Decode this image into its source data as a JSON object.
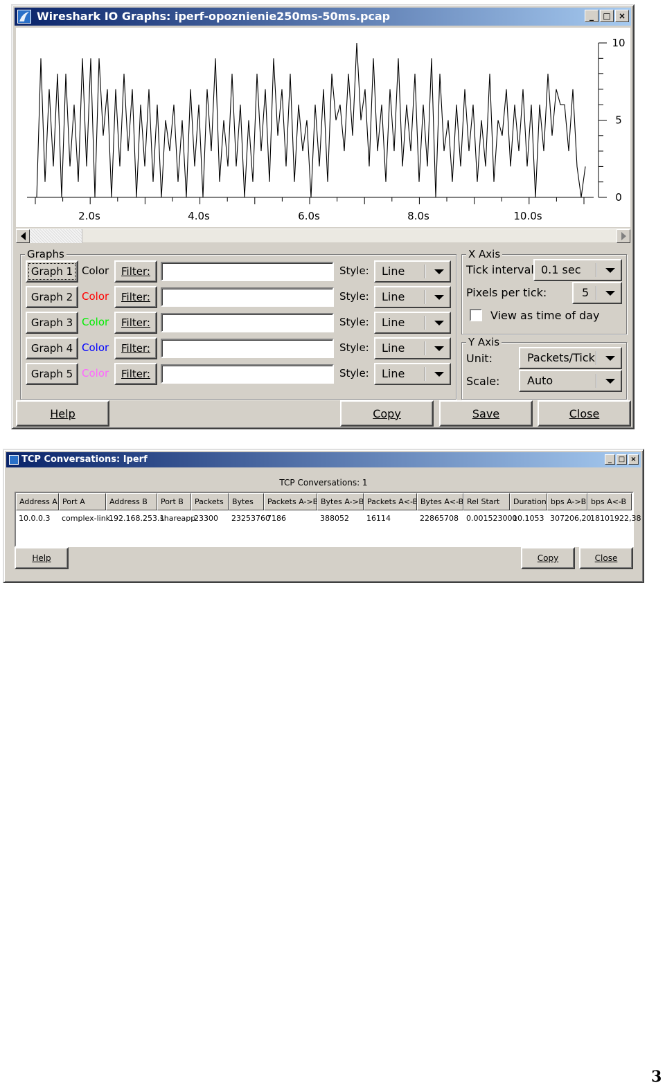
{
  "io_window": {
    "title": "Wireshark IO Graphs: iperf-opoznienie250ms-50ms.pcap",
    "title_buttons": [
      "_",
      "□",
      "×"
    ],
    "chart_data": {
      "type": "line",
      "title": "",
      "x_tick_labels": [
        "2.0s",
        "4.0s",
        "6.0s",
        "8.0s",
        "10.0s"
      ],
      "y_tick_labels": [
        "10",
        "5",
        "0"
      ],
      "ylim": [
        0,
        10
      ],
      "series": [
        {
          "values": [
            0,
            9,
            1,
            7,
            2,
            8,
            0,
            8,
            2,
            6,
            1,
            9,
            2,
            9,
            0,
            9,
            4,
            7,
            0,
            7,
            2,
            8,
            3,
            7,
            0,
            6,
            2,
            7,
            1,
            6,
            0,
            5,
            3,
            6,
            1,
            5,
            0,
            7,
            2,
            6,
            0,
            7,
            3,
            9,
            1,
            5,
            2,
            8,
            2,
            6,
            0,
            5,
            1,
            8,
            3,
            7,
            1,
            9,
            4,
            7,
            2,
            8,
            1,
            6,
            3,
            5,
            0,
            6,
            2,
            7,
            1,
            8,
            5,
            6,
            3,
            8,
            4,
            10,
            5,
            7,
            2,
            9,
            3,
            6,
            1,
            7,
            3,
            9,
            2,
            6,
            3,
            8,
            1,
            6,
            2,
            9,
            0,
            8,
            3,
            5,
            1,
            6,
            2,
            7,
            3,
            6,
            1,
            5,
            2,
            8,
            1,
            5,
            4,
            7,
            2,
            6,
            3,
            7,
            2,
            6,
            0,
            6,
            3,
            8,
            4,
            7,
            6,
            6,
            3,
            7,
            2,
            0,
            2
          ]
        }
      ],
      "grid": false
    },
    "graphs_group": {
      "legend": "Graphs",
      "rows": [
        {
          "button": "Graph 1",
          "color_label": "Color",
          "color": "#000000",
          "filter_label": "Filter:",
          "filter_value": "",
          "style_label": "Style:",
          "style_value": "Line"
        },
        {
          "button": "Graph 2",
          "color_label": "Color",
          "color": "#ff0000",
          "filter_label": "Filter:",
          "filter_value": "",
          "style_label": "Style:",
          "style_value": "Line"
        },
        {
          "button": "Graph 3",
          "color_label": "Color",
          "color": "#00ee00",
          "filter_label": "Filter:",
          "filter_value": "",
          "style_label": "Style:",
          "style_value": "Line"
        },
        {
          "button": "Graph 4",
          "color_label": "Color",
          "color": "#0000ff",
          "filter_label": "Filter:",
          "filter_value": "",
          "style_label": "Style:",
          "style_value": "Line"
        },
        {
          "button": "Graph 5",
          "color_label": "Color",
          "color": "#ff66ff",
          "filter_label": "Filter:",
          "filter_value": "",
          "style_label": "Style:",
          "style_value": "Line"
        }
      ]
    },
    "x_axis": {
      "legend": "X Axis",
      "tick_interval_label": "Tick interval:",
      "tick_interval_value": "0.1 sec",
      "pixels_per_tick_label": "Pixels per tick:",
      "pixels_per_tick_value": "5",
      "view_time_label": "View as time of day",
      "view_time_checked": false
    },
    "y_axis": {
      "legend": "Y Axis",
      "unit_label": "Unit:",
      "unit_value": "Packets/Tick",
      "scale_label": "Scale:",
      "scale_value": "Auto"
    },
    "buttons": {
      "help": "Help",
      "copy": "Copy",
      "save": "Save",
      "close": "Close"
    }
  },
  "tcp_window": {
    "title": "TCP Conversations: Iperf",
    "title_buttons": [
      "_",
      "□",
      "×"
    ],
    "caption": "TCP Conversations: 1",
    "columns": [
      "Address A",
      "Port A",
      "Address B",
      "Port B",
      "Packets",
      "Bytes",
      "Packets A->B",
      "Bytes A->B",
      "Packets A<-B",
      "Bytes A<-B",
      "Rel Start",
      "Duration",
      "bps A->B",
      "bps A<-B"
    ],
    "rows": [
      [
        "10.0.0.3",
        "complex-link",
        "192.168.253.1",
        "shareapp",
        "23300",
        "23253760",
        "7186",
        "388052",
        "16114",
        "22865708",
        "0.001523000",
        "10.1053",
        "307206,20",
        "18101922,38"
      ]
    ],
    "buttons": {
      "help": "Help",
      "copy": "Copy",
      "close": "Close"
    }
  },
  "page_number": "3"
}
